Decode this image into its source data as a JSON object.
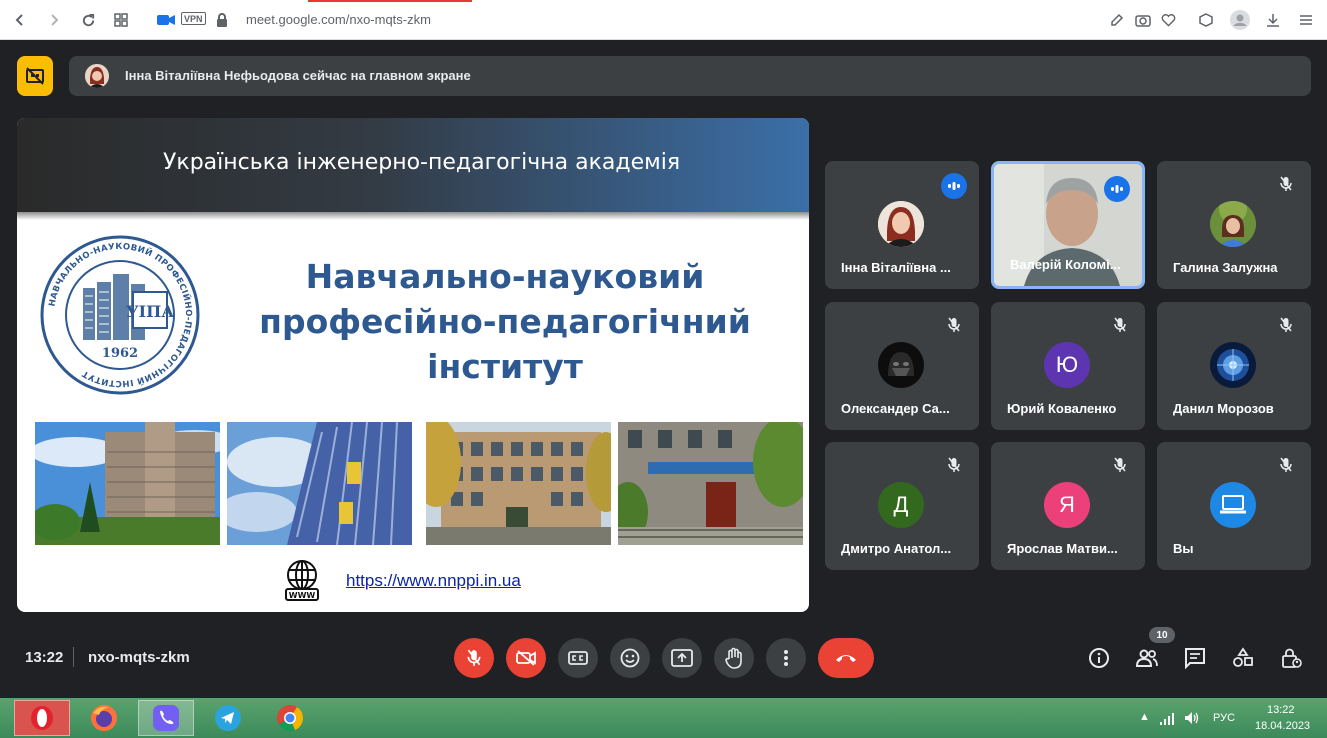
{
  "browser": {
    "url": "meet.google.com/nxo-mqts-zkm",
    "vpn_label": "VPN"
  },
  "banner": {
    "text": "Інна Віталіївна Нефьодова сейчас на главном экране"
  },
  "slide": {
    "header_title": "Українська інженерно-педагогічна академія",
    "title_line1": "Навчально-науковий",
    "title_line2": "професійно-педагогічний",
    "title_line3": "інститут",
    "link": "https://www.nnppi.in.ua",
    "logo_abbr": "УІПА",
    "logo_year": "1962",
    "logo_ring_text": "НАВЧАЛЬНО-НАУКОВИЙ ПРОФЕСІЙНО-ПЕДАГОГІЧНИЙ ІНСТИТУТ",
    "www_label": "WWW"
  },
  "participants": [
    {
      "name": "Інна Віталіївна ...",
      "state": "speaking",
      "avatar_type": "photo",
      "color": "#d7b8a8"
    },
    {
      "name": "Валерій Коломі...",
      "state": "speaking",
      "avatar_type": "video",
      "color": "#cfd2cc"
    },
    {
      "name": "Галина Залужна",
      "state": "muted",
      "avatar_type": "photo",
      "color": "#7a9a4a"
    },
    {
      "name": "Олександер Са...",
      "state": "muted",
      "avatar_type": "photo",
      "color": "#1a1a1a"
    },
    {
      "name": "Юрий Коваленко",
      "state": "muted",
      "avatar_type": "letter",
      "letter": "Ю",
      "color": "#5e35b1"
    },
    {
      "name": "Данил Морозов",
      "state": "muted",
      "avatar_type": "photo",
      "color": "#2a5aa8"
    },
    {
      "name": "Дмитро Анатол...",
      "state": "muted",
      "avatar_type": "letter",
      "letter": "Д",
      "color": "#33691e"
    },
    {
      "name": "Ярослав Матви...",
      "state": "muted",
      "avatar_type": "letter",
      "letter": "Я",
      "color": "#ec407a"
    },
    {
      "name": "Вы",
      "state": "muted",
      "avatar_type": "icon",
      "color": "#1e88e5"
    }
  ],
  "controls": {
    "time": "13:22",
    "meeting_code": "nxo-mqts-zkm",
    "people_count": "10"
  },
  "taskbar": {
    "language": "РУС",
    "time": "13:22",
    "date": "18.04.2023"
  },
  "colors": {
    "meet_bg": "#202124",
    "tile_bg": "#3c4043",
    "danger": "#ea4335",
    "accent": "#1a73e8",
    "pin_yellow": "#fbbc04"
  }
}
